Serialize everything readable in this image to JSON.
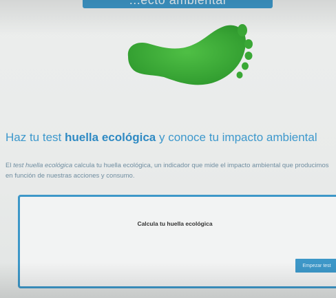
{
  "header": {
    "title_partial": "...ecto ambiental"
  },
  "hero": {
    "image": "green-footprint-icon"
  },
  "main": {
    "headline_pre": "Haz tu test ",
    "headline_bold": "huella ecológica",
    "headline_post": " y conoce tu impacto ambiental",
    "desc_pre": "El ",
    "desc_italic": "test huella ecológica",
    "desc_post": " calcula tu huella ecológica, un indicador que mide el impacto ambiental que producimos en función de nuestras acciones y consumo."
  },
  "card": {
    "title": "Calcula tu huella ecológica",
    "button_label": "Empezar test"
  },
  "colors": {
    "accent": "#3d97c8",
    "footprint": "#3aa836"
  }
}
